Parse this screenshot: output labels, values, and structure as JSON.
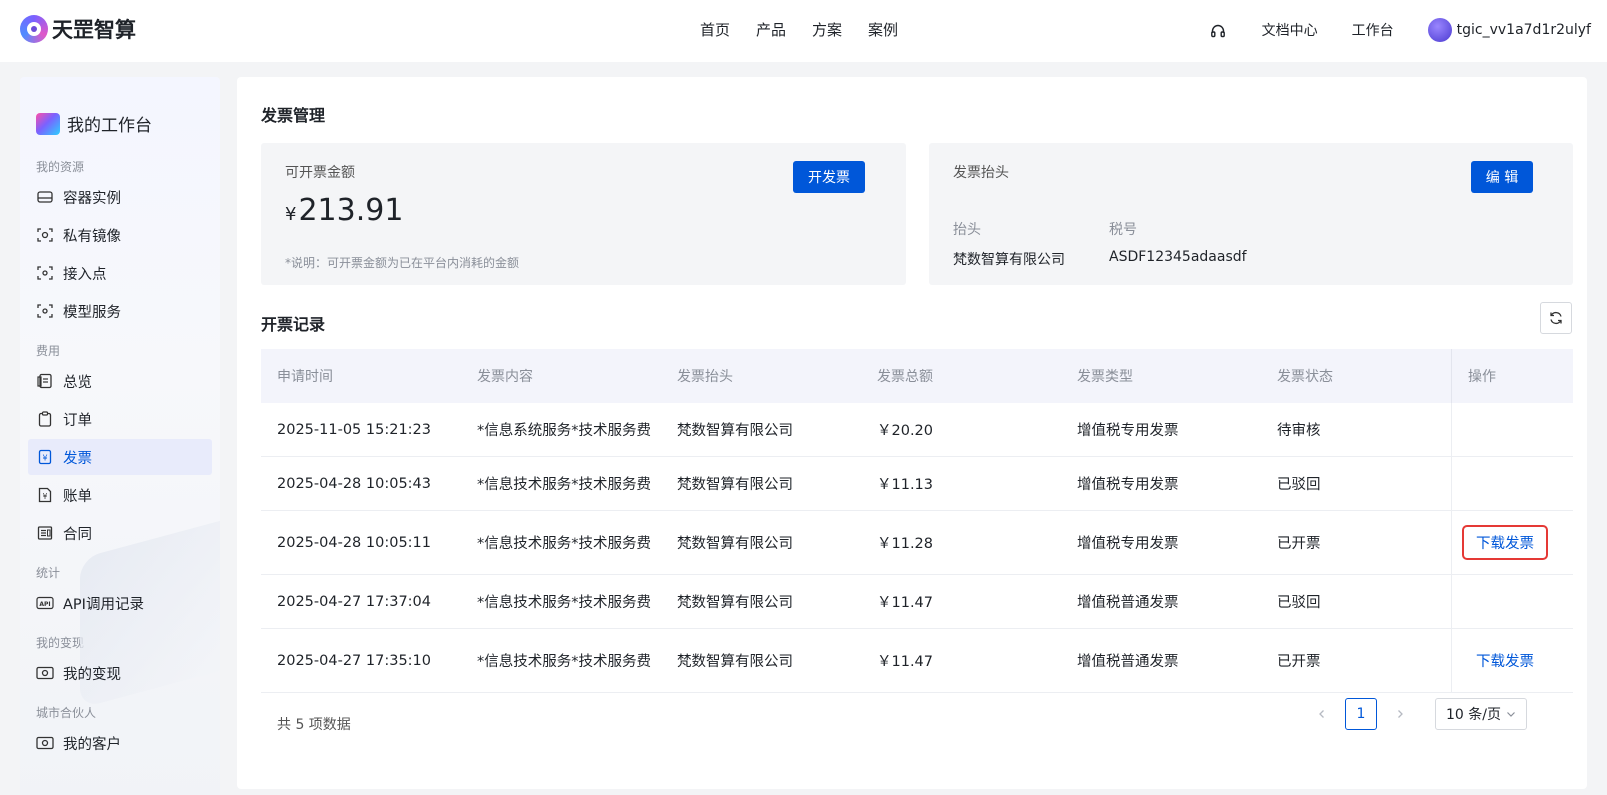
{
  "brand": {
    "name": "天罡智算"
  },
  "nav": [
    "首页",
    "产品",
    "方案",
    "案例"
  ],
  "topright": {
    "docs": "文档中心",
    "workbench": "工作台",
    "username": "tgic_vv1a7d1r2ulyf"
  },
  "sidebar": {
    "title": "我的工作台",
    "groups": [
      {
        "label": "我的资源",
        "items": [
          {
            "label": "容器实例",
            "icon": "server-icon"
          },
          {
            "label": "私有镜像",
            "icon": "image-scan-icon"
          },
          {
            "label": "接入点",
            "icon": "endpoint-icon"
          },
          {
            "label": "模型服务",
            "icon": "model-icon"
          }
        ]
      },
      {
        "label": "费用",
        "items": [
          {
            "label": "总览",
            "icon": "overview-icon"
          },
          {
            "label": "订单",
            "icon": "clipboard-icon"
          },
          {
            "label": "发票",
            "icon": "invoice-icon",
            "active": true
          },
          {
            "label": "账单",
            "icon": "bill-icon"
          },
          {
            "label": "合同",
            "icon": "contract-icon"
          }
        ]
      },
      {
        "label": "统计",
        "items": [
          {
            "label": "API调用记录",
            "icon": "api-icon"
          }
        ]
      },
      {
        "label": "我的变现",
        "items": [
          {
            "label": "我的变现",
            "icon": "monetize-icon"
          }
        ]
      },
      {
        "label": "城市合伙人",
        "items": [
          {
            "label": "我的客户",
            "icon": "customer-icon"
          }
        ]
      }
    ]
  },
  "page": {
    "title": "发票管理",
    "invoiceable": {
      "label": "可开票金额",
      "currency": "¥",
      "amount": "213.91",
      "note": "*说明：可开票金额为已在平台内消耗的金额",
      "button": "开发票"
    },
    "header": {
      "label": "发票抬头",
      "button": "编 辑",
      "title_key": "抬头",
      "title_value": "梵数智算有限公司",
      "tax_key": "税号",
      "tax_value": "ASDF12345adaasdf"
    },
    "records_title": "开票记录"
  },
  "table": {
    "columns": [
      "申请时间",
      "发票内容",
      "发票抬头",
      "发票总额",
      "发票类型",
      "发票状态",
      "操作"
    ],
    "rows": [
      {
        "time": "2025-11-05 15:21:23",
        "content": "*信息系统服务*技术服务费",
        "header": "梵数智算有限公司",
        "total": "￥20.20",
        "type": "增值税专用发票",
        "status": "待审核",
        "action": ""
      },
      {
        "time": "2025-04-28 10:05:43",
        "content": "*信息技术服务*技术服务费",
        "header": "梵数智算有限公司",
        "total": "￥11.13",
        "type": "增值税专用发票",
        "status": "已驳回",
        "action": ""
      },
      {
        "time": "2025-04-28 10:05:11",
        "content": "*信息技术服务*技术服务费",
        "header": "梵数智算有限公司",
        "total": "￥11.28",
        "type": "增值税专用发票",
        "status": "已开票",
        "action": "下载发票"
      },
      {
        "time": "2025-04-27 17:37:04",
        "content": "*信息技术服务*技术服务费",
        "header": "梵数智算有限公司",
        "total": "￥11.47",
        "type": "增值税普通发票",
        "status": "已驳回",
        "action": ""
      },
      {
        "time": "2025-04-27 17:35:10",
        "content": "*信息技术服务*技术服务费",
        "header": "梵数智算有限公司",
        "total": "￥11.47",
        "type": "增值税普通发票",
        "status": "已开票",
        "action": "下载发票"
      }
    ]
  },
  "pagination": {
    "total_text": "共 5 项数据",
    "current": "1",
    "page_size": "10 条/页"
  },
  "colors": {
    "primary": "#0057d9",
    "highlight": "#e53935",
    "active_bg": "#e8ebfb"
  }
}
